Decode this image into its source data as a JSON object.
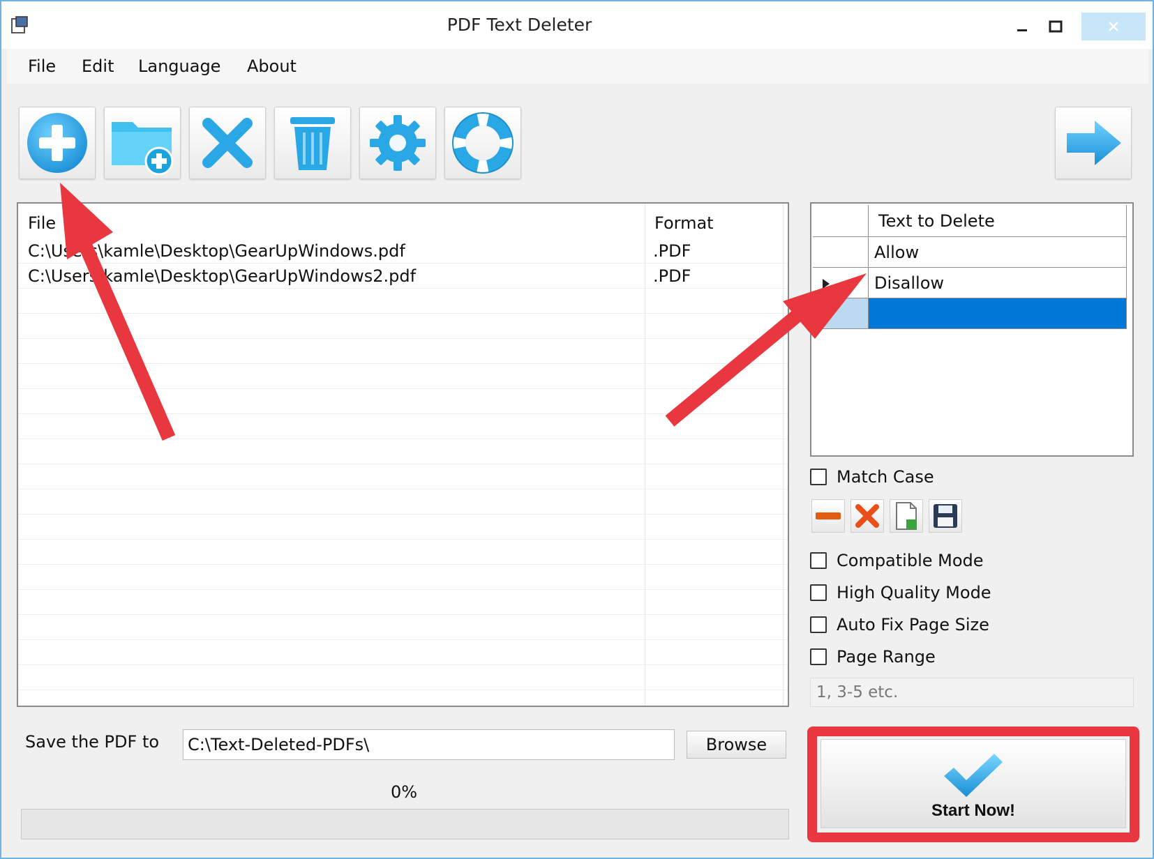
{
  "window": {
    "title": "PDF Text Deleter"
  },
  "menu": {
    "file": "File",
    "edit": "Edit",
    "language": "Language",
    "about": "About"
  },
  "toolbar": {
    "buttons": [
      "add-file",
      "add-folder",
      "remove",
      "clear",
      "settings",
      "help"
    ],
    "next": "next"
  },
  "file_list": {
    "headers": {
      "file": "File",
      "format": "Format"
    },
    "rows": [
      {
        "path": "C:\\Users\\kamle\\Desktop\\GearUpWindows.pdf",
        "format": ".PDF"
      },
      {
        "path": "C:\\Users\\kamle\\Desktop\\GearUpWindows2.pdf",
        "format": ".PDF"
      }
    ]
  },
  "text_grid": {
    "header": "Text to Delete",
    "rows": [
      "Allow",
      "Disallow",
      ""
    ]
  },
  "options": {
    "match_case": "Match Case",
    "compatible_mode": "Compatible Mode",
    "high_quality_mode": "High Quality Mode",
    "auto_fix_page_size": "Auto Fix Page Size",
    "page_range": "Page Range",
    "page_range_placeholder": "1, 3-5 etc."
  },
  "output": {
    "save_label": "Save the PDF to",
    "save_path": "C:\\Text-Deleted-PDFs\\",
    "browse": "Browse"
  },
  "progress": {
    "percent_text": "0%",
    "value": 0
  },
  "start": {
    "label": "Start Now!"
  },
  "colors": {
    "accent": "#35a9e4",
    "annotation": "#e8373e",
    "selection": "#0078d7"
  }
}
